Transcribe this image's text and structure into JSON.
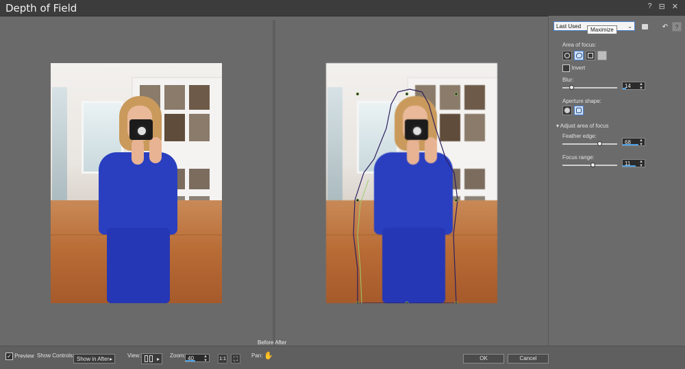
{
  "window": {
    "title": "Depth of Field",
    "controls": [
      "?",
      "⊟",
      "✕"
    ]
  },
  "panes": {
    "before_label": "Before",
    "after_label": "After"
  },
  "bottombar": {
    "preview_label": "Preview",
    "show_controls_label": "Show Controls:",
    "show_controls_value": "Show in After",
    "view_label": "View:",
    "zoom_label": "Zoom:",
    "zoom_value": "40",
    "pan_label": "Pan:",
    "ok_label": "OK",
    "cancel_label": "Cancel"
  },
  "panel": {
    "preset_value": "Last Used",
    "tooltip": "Maximize",
    "area_of_focus_label": "Area of focus:",
    "invert_label": "Invert",
    "blur_label": "Blur:",
    "blur_value": "14",
    "blur_fraction": 0.16,
    "aperture_label": "Aperture shape:",
    "adjust_label": "Adjust area of focus",
    "feather_label": "Feather edge:",
    "feather_value": "68",
    "feather_fraction": 0.68,
    "focus_range_label": "Focus range:",
    "focus_range_value": "11",
    "focus_range_fraction": 0.55
  },
  "colors": {
    "accent": "#4a7fd4",
    "spin_bar": "#4aa0e6"
  }
}
